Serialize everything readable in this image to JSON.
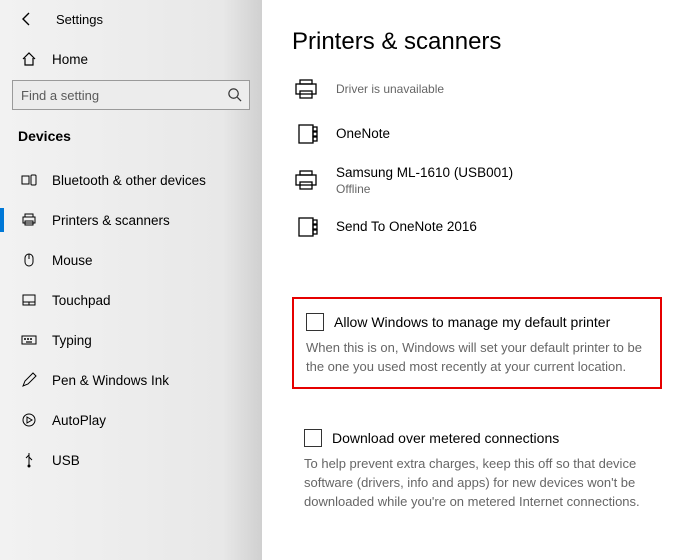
{
  "header": {
    "title": "Settings"
  },
  "home_label": "Home",
  "search": {
    "placeholder": "Find a setting"
  },
  "group_label": "Devices",
  "nav": [
    {
      "label": "Bluetooth & other devices"
    },
    {
      "label": "Printers & scanners"
    },
    {
      "label": "Mouse"
    },
    {
      "label": "Touchpad"
    },
    {
      "label": "Typing"
    },
    {
      "label": "Pen & Windows Ink"
    },
    {
      "label": "AutoPlay"
    },
    {
      "label": "USB"
    }
  ],
  "page_title": "Printers & scanners",
  "printers": [
    {
      "name": "",
      "status": "Driver is unavailable"
    },
    {
      "name": "OneNote",
      "status": ""
    },
    {
      "name": "Samsung ML-1610 (USB001)",
      "status": "Offline"
    },
    {
      "name": "Send To OneNote 2016",
      "status": ""
    }
  ],
  "default_printer": {
    "label": "Allow Windows to manage my default printer",
    "desc": "When this is on, Windows will set your default printer to be the one you used most recently at your current location."
  },
  "metered": {
    "label": "Download over metered connections",
    "desc": "To help prevent extra charges, keep this off so that device software (drivers, info and apps) for new devices won't be downloaded while you're on metered Internet connections."
  }
}
